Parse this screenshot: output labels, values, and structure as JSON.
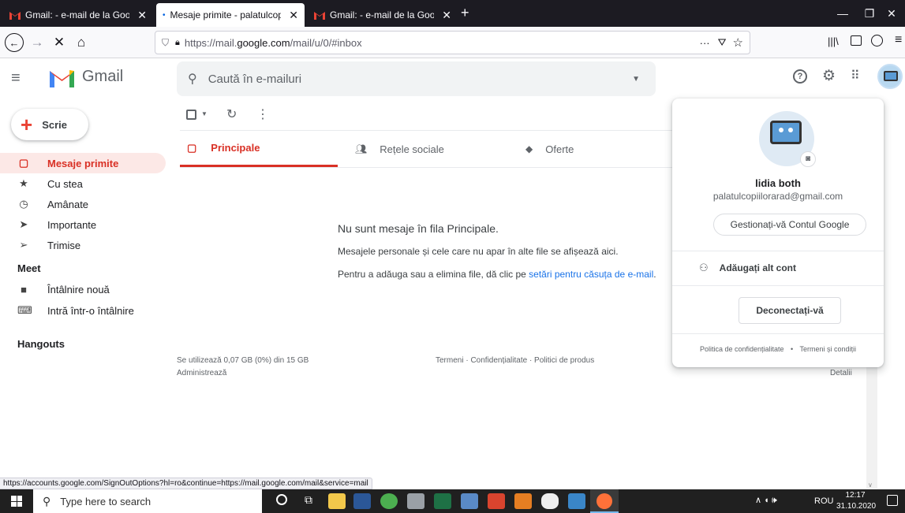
{
  "browser": {
    "tabs": [
      {
        "title": "Gmail: - e-mail de la Google",
        "close": "✕"
      },
      {
        "title": "Mesaje primite - palatulcopiilor",
        "close": "✕"
      },
      {
        "title": "Gmail: - e-mail de la Google",
        "close": "✕"
      }
    ],
    "new_tab": "+",
    "url_prefix": "https://mail.",
    "url_domain": "google.com",
    "url_suffix": "/mail/u/0/#inbox",
    "status_url": "https://accounts.google.com/SignOutOptions?hl=ro&continue=https://mail.google.com/mail&service=mail"
  },
  "gmail": {
    "logo_text": "Gmail",
    "search_placeholder": "Caută în e-mailuri",
    "compose_label": "Scrie",
    "sidebar": {
      "items": [
        {
          "label": "Mesaje primite"
        },
        {
          "label": "Cu stea"
        },
        {
          "label": "Amânate"
        },
        {
          "label": "Importante"
        },
        {
          "label": "Trimise"
        }
      ],
      "meet_heading": "Meet",
      "meet_items": [
        {
          "label": "Întâlnire nouă"
        },
        {
          "label": "Intră într-o întâlnire"
        }
      ],
      "hangouts_heading": "Hangouts"
    },
    "category_tabs": [
      {
        "label": "Principale"
      },
      {
        "label": "Rețele sociale"
      },
      {
        "label": "Oferte"
      }
    ],
    "empty": {
      "title": "Nu sunt mesaje în fila Principale.",
      "line1": "Mesajele personale și cele care nu apar în alte file se afișează aici.",
      "line2_prefix": "Pentru a adăuga sau a elimina file, dă clic pe ",
      "line2_link": "setări pentru căsuța de e-mail",
      "line2_suffix": "."
    },
    "footer": {
      "storage": "Se utilizează 0,07 GB (0%) din 15 GB",
      "manage": "Administrează",
      "links": "Termeni · Confidențialitate · Politici de produs",
      "details": "Detalii"
    }
  },
  "account_popup": {
    "name": "lidia both",
    "email": "palatulcopiilorarad@gmail.com",
    "manage_button": "Gestionați-vă Contul Google",
    "add_account": "Adăugați alt cont",
    "signout_button": "Deconectați-vă",
    "privacy": "Politica de confidențialitate",
    "dot": "•",
    "terms": "Termeni și condiții"
  },
  "taskbar": {
    "search_placeholder": "Type here to search",
    "language": "ROU",
    "time": "12:17",
    "date": "31.10.2020"
  },
  "colors": {
    "gmail_red": "#d93025",
    "link_blue": "#1a73e8",
    "taskbar": "#202020"
  }
}
